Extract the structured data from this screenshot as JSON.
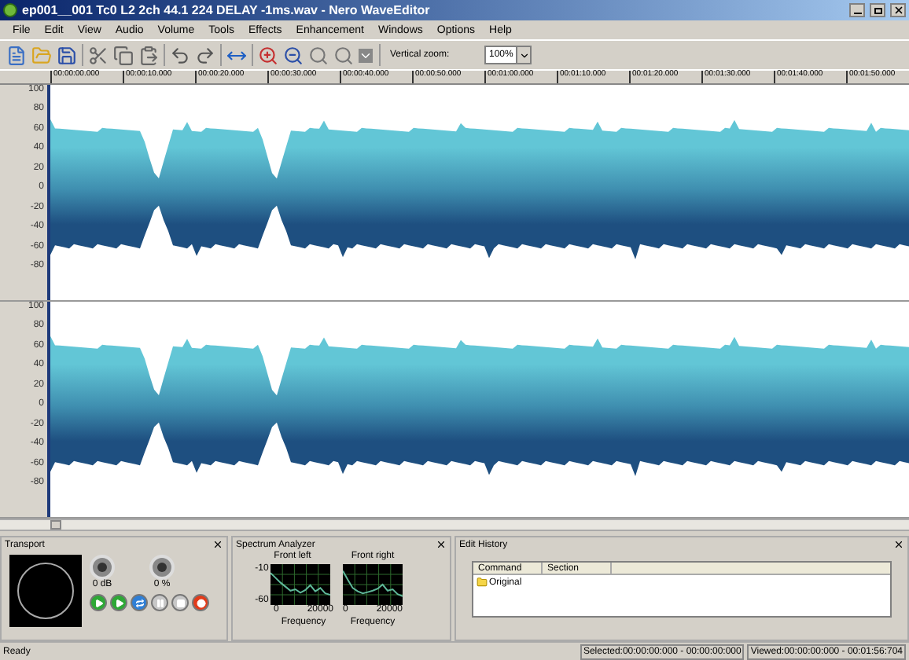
{
  "window": {
    "title": "ep001__001 Tc0 L2 2ch 44.1 224 DELAY -1ms.wav - Nero WaveEditor"
  },
  "menu": [
    "File",
    "Edit",
    "View",
    "Audio",
    "Volume",
    "Tools",
    "Effects",
    "Enhancement",
    "Windows",
    "Options",
    "Help"
  ],
  "toolbar": {
    "vertical_zoom_label": "Vertical zoom:",
    "vertical_zoom_value": "100%"
  },
  "ruler": [
    "00:00:00.000",
    "00:00:10.000",
    "00:00:20.000",
    "00:00:30.000",
    "00:00:40.000",
    "00:00:50.000",
    "00:01:00.000",
    "00:01:10.000",
    "00:01:20.000",
    "00:01:30.000",
    "00:01:40.000",
    "00:01:50.000"
  ],
  "channels": [
    {
      "axis": [
        "100",
        "80",
        "60",
        "40",
        "20",
        "0",
        "-20",
        "-40",
        "-60",
        "-80"
      ]
    },
    {
      "axis": [
        "100",
        "80",
        "60",
        "40",
        "20",
        "0",
        "-20",
        "-40",
        "-60",
        "-80"
      ]
    }
  ],
  "transport": {
    "title": "Transport",
    "volume": "0 dB",
    "pan": "0 %",
    "buttons": [
      {
        "kind": "play"
      },
      {
        "kind": "play-selection"
      },
      {
        "kind": "loop"
      },
      {
        "kind": "pause"
      },
      {
        "kind": "stop"
      },
      {
        "kind": "record"
      }
    ]
  },
  "spectrum": {
    "title": "Spectrum Analyzer",
    "charts": [
      {
        "title": "Front left",
        "y_ticks": [
          "-10",
          "-60"
        ],
        "x_ticks": [
          "0",
          "20000"
        ],
        "xlabel": "Frequency"
      },
      {
        "title": "Front right",
        "x_ticks": [
          "0",
          "20000"
        ],
        "xlabel": "Frequency"
      }
    ]
  },
  "history": {
    "title": "Edit History",
    "columns": [
      "Command",
      "Section"
    ],
    "rows": [
      {
        "command": "Original"
      }
    ]
  },
  "status_bar": {
    "message": "Ready",
    "selected": "Selected:00:00:00:000 - 00:00:00:000",
    "viewed": "Viewed:00:00:00:000 - 00:01:56:704"
  }
}
